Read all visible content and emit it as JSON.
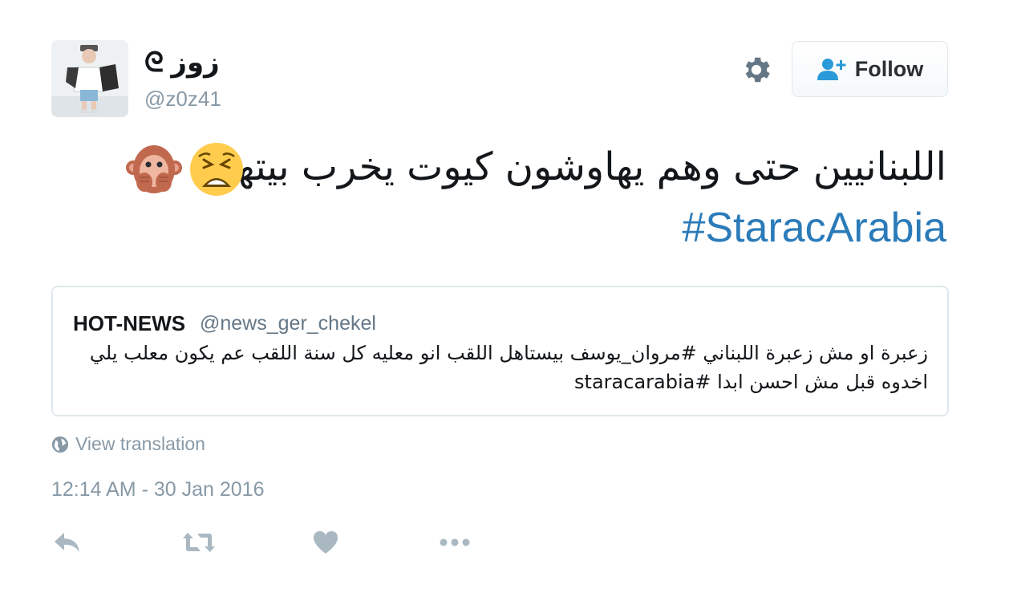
{
  "author": {
    "display_name": "ᘓ زوز",
    "handle": "@z0z41",
    "avatar_icon": "profile-photo"
  },
  "follow_button": {
    "label": "Follow",
    "icon": "follow-user-icon"
  },
  "settings_icon": "gear-icon",
  "tweet": {
    "text": "اللبنانيين حتى وهم يهاوشون كيوت يخرب بيتهم",
    "emojis": [
      "weary-face-emoji",
      "speak-no-evil-monkey-emoji"
    ],
    "hashtag": "#StaracArabia"
  },
  "quoted_tweet": {
    "name": "HOT-NEWS",
    "handle": "@news_ger_chekel",
    "text": "زعبرة او مش زعبرة اللبناني #مروان_يوسف بيستاهل اللقب انو معليه كل سنة اللقب عم يكون معلب يلي اخدوه قبل مش احسن ابدا #staracarabia"
  },
  "view_translation": {
    "label": "View translation",
    "icon": "globe-icon"
  },
  "timestamp": "12:14 AM - 30 Jan 2016",
  "actions": [
    "reply-icon",
    "retweet-icon",
    "like-heart-icon",
    "more-dots-icon"
  ],
  "colors": {
    "link": "#2b7bb9",
    "muted": "#8899a6",
    "border": "#e1e8ed"
  }
}
